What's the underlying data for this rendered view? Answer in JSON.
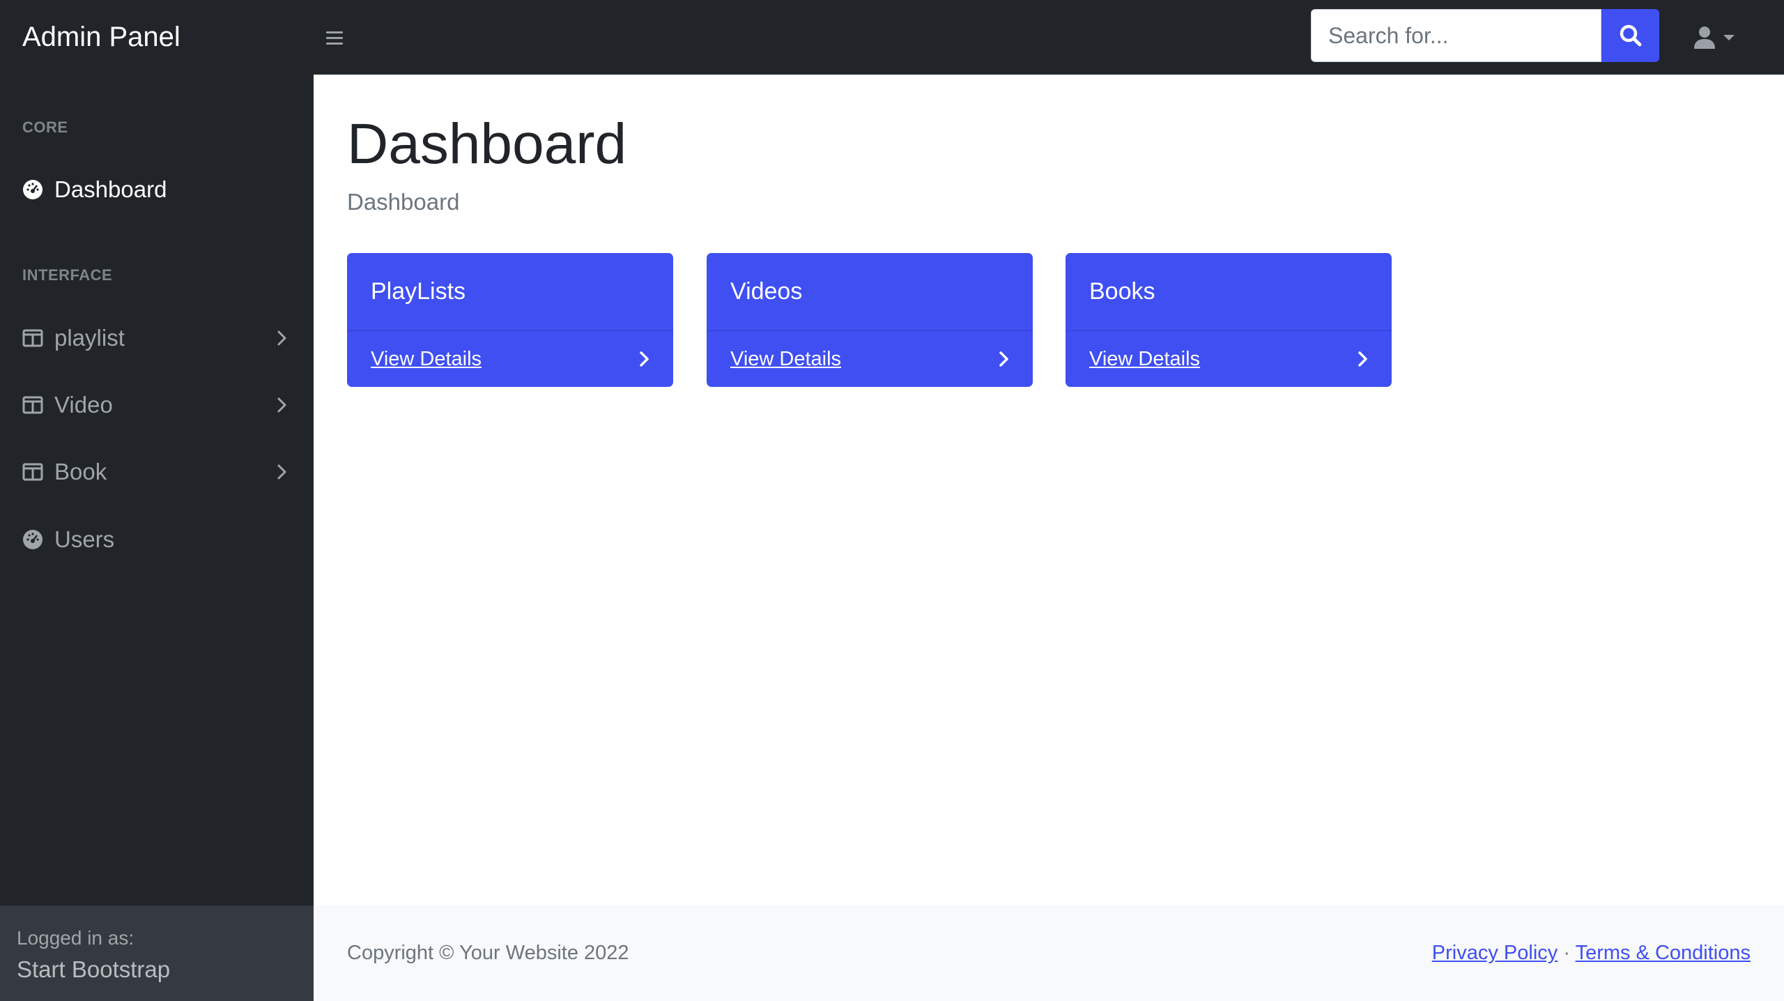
{
  "topnav": {
    "brand": "Admin Panel",
    "search_placeholder": "Search for...",
    "toggle_icon": "hamburger-icon",
    "search_icon": "search-icon",
    "user_icon": "user-icon"
  },
  "sidebar": {
    "headings": [
      "CORE",
      "INTERFACE"
    ],
    "items": [
      {
        "label": "Dashboard",
        "icon": "tachometer-icon",
        "active": true
      },
      {
        "label": "playlist",
        "icon": "columns-icon",
        "collapsible": true
      },
      {
        "label": "Video",
        "icon": "columns-icon",
        "collapsible": true
      },
      {
        "label": "Book",
        "icon": "columns-icon",
        "collapsible": true
      },
      {
        "label": "Users",
        "icon": "tachometer-icon"
      }
    ],
    "footer": {
      "logged_in_label": "Logged in as:",
      "user_name": "Start Bootstrap"
    }
  },
  "main": {
    "title": "Dashboard",
    "breadcrumb": "Dashboard",
    "cards": [
      {
        "title": "PlayLists",
        "link": "View Details"
      },
      {
        "title": "Videos",
        "link": "View Details"
      },
      {
        "title": "Books",
        "link": "View Details"
      }
    ]
  },
  "footer": {
    "copyright": "Copyright © Your Website 2022",
    "separator": "·",
    "privacy": "Privacy Policy",
    "terms": "Terms & Conditions"
  },
  "colors": {
    "primary": "#3f4ff2",
    "sidebar": "#212529",
    "footer_bg": "#f8f9fa"
  }
}
